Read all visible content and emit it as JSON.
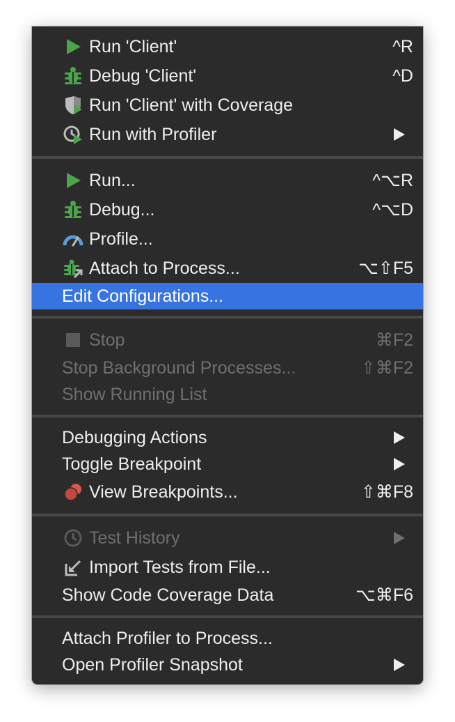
{
  "menu": {
    "items": [
      {
        "label": "Run 'Client'",
        "shortcut": "^R",
        "icon": "run-icon"
      },
      {
        "label": "Debug 'Client'",
        "shortcut": "^D",
        "icon": "debug-bug-icon"
      },
      {
        "label": "Run 'Client' with Coverage",
        "shortcut": "",
        "icon": "coverage-shield-icon"
      },
      {
        "label": "Run with Profiler",
        "shortcut": "",
        "icon": "profiler-clock-icon",
        "submenu": true
      },
      {
        "label": "Run...",
        "shortcut": "^⌥R",
        "icon": "run-icon"
      },
      {
        "label": "Debug...",
        "shortcut": "^⌥D",
        "icon": "debug-bug-icon"
      },
      {
        "label": "Profile...",
        "shortcut": "",
        "icon": "profile-gauge-icon"
      },
      {
        "label": "Attach to Process...",
        "shortcut": "⌥⇧F5",
        "icon": "attach-process-icon"
      },
      {
        "label": "Edit Configurations...",
        "shortcut": "",
        "highlighted": true
      },
      {
        "label": "Stop",
        "shortcut": "⌘F2",
        "icon": "stop-square-icon",
        "disabled": true
      },
      {
        "label": "Stop Background Processes...",
        "shortcut": "⇧⌘F2",
        "disabled": true
      },
      {
        "label": "Show Running List",
        "shortcut": "",
        "disabled": true
      },
      {
        "label": "Debugging Actions",
        "shortcut": "",
        "submenu": true
      },
      {
        "label": "Toggle Breakpoint",
        "shortcut": "",
        "submenu": true
      },
      {
        "label": "View Breakpoints...",
        "shortcut": "⇧⌘F8",
        "icon": "breakpoints-icon"
      },
      {
        "label": "Test History",
        "shortcut": "",
        "icon": "history-clock-icon",
        "submenu": true,
        "disabled": true
      },
      {
        "label": "Import Tests from File...",
        "shortcut": "",
        "icon": "import-arrow-icon"
      },
      {
        "label": "Show Code Coverage Data",
        "shortcut": "⌥⌘F6"
      },
      {
        "label": "Attach Profiler to Process...",
        "shortcut": ""
      },
      {
        "label": "Open Profiler Snapshot",
        "shortcut": "",
        "submenu": true
      }
    ]
  },
  "colors": {
    "background": "#2b2b2c",
    "highlight": "#3774e2",
    "text": "#eeeeee",
    "disabled_text": "#6f6f71",
    "run_green": "#4aa64a",
    "separator": "#474749"
  }
}
